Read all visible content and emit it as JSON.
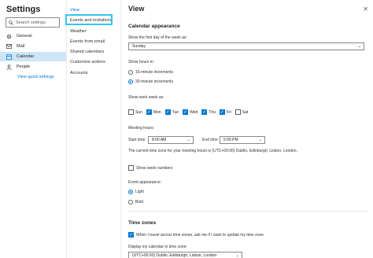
{
  "nav": {
    "title": "Settings",
    "search_placeholder": "Search settings",
    "items": [
      {
        "label": "General",
        "icon": "gear-icon",
        "selected": false
      },
      {
        "label": "Mail",
        "icon": "mail-icon",
        "selected": false
      },
      {
        "label": "Calendar",
        "icon": "calendar-icon",
        "selected": true
      },
      {
        "label": "People",
        "icon": "people-icon",
        "selected": false
      }
    ],
    "quick_link": "View quick settings"
  },
  "subnav": {
    "items": [
      {
        "label": "View",
        "active": true
      },
      {
        "label": "Events and invitations",
        "active": false
      },
      {
        "label": "Weather",
        "active": false
      },
      {
        "label": "Events from email",
        "active": false
      },
      {
        "label": "Shared calendars",
        "active": false
      },
      {
        "label": "Customize actions",
        "active": false
      },
      {
        "label": "Accounts",
        "active": false
      }
    ]
  },
  "main": {
    "title": "View",
    "calendar_appearance": {
      "heading": "Calendar appearance",
      "first_day_label": "Show the first day of the week as:",
      "first_day_value": "Sunday",
      "show_hours_label": "Show hours in:",
      "hours_options": [
        {
          "label": "15-minute increments",
          "selected": false
        },
        {
          "label": "30-minute increments",
          "selected": true
        }
      ],
      "work_week_label": "Show work week as:",
      "days": [
        {
          "label": "Sun",
          "checked": false
        },
        {
          "label": "Mon",
          "checked": true
        },
        {
          "label": "Tue",
          "checked": true
        },
        {
          "label": "Wed",
          "checked": true
        },
        {
          "label": "Thu",
          "checked": true
        },
        {
          "label": "Fri",
          "checked": true
        },
        {
          "label": "Sat",
          "checked": false
        }
      ],
      "meeting_hours_label": "Meeting hours:",
      "start_time_label": "Start time",
      "start_time_value": "8:00 AM",
      "end_time_label": "End time",
      "end_time_value": "5:00 PM",
      "timezone_note": "The current time zone for your meeting hours is (UTC+00:00) Dublin, Edinburgh, Lisbon, London.",
      "week_numbers_label": "Show week numbers",
      "week_numbers_checked": false,
      "event_appearance_label": "Event appearance:",
      "event_options": [
        {
          "label": "Light",
          "selected": true
        },
        {
          "label": "Bold",
          "selected": false
        }
      ]
    },
    "time_zones": {
      "heading": "Time zones",
      "travel_label": "When I travel across time zones, ask me if I want to update my time zone",
      "travel_checked": true,
      "display_label": "Display my calendar in time zone:",
      "display_value": "(UTC+00:00) Dublin, Edinburgh, Lisbon, London"
    }
  },
  "colors": {
    "accent": "#0078d4",
    "selected_bg": "#cde6f7",
    "highlight": "#34c4f0"
  }
}
